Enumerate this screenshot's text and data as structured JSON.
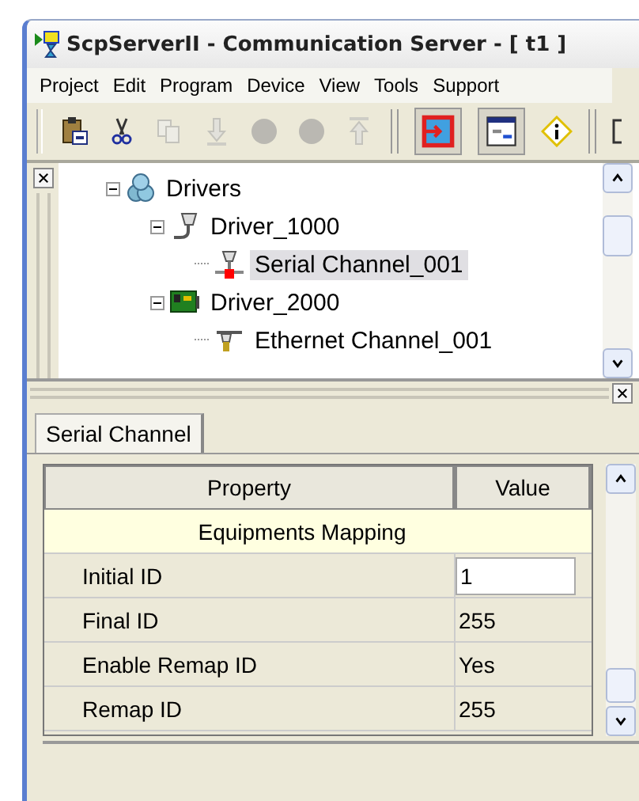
{
  "window": {
    "title": "ScpServerII - Communication Server - [ t1 ]"
  },
  "menu": [
    {
      "label": "Project"
    },
    {
      "label": "Edit"
    },
    {
      "label": "Program"
    },
    {
      "label": "Device"
    },
    {
      "label": "View"
    },
    {
      "label": "Tools"
    },
    {
      "label": "Support"
    }
  ],
  "toolbar": [
    {
      "kind": "paste",
      "disabled": false
    },
    {
      "kind": "cut",
      "disabled": false
    },
    {
      "kind": "copy",
      "disabled": true
    },
    {
      "kind": "download",
      "disabled": true
    },
    {
      "kind": "circle",
      "disabled": true
    },
    {
      "kind": "circle",
      "disabled": true
    },
    {
      "kind": "upload",
      "disabled": true
    },
    {
      "kind": "sep"
    },
    {
      "kind": "exit",
      "disabled": false
    },
    {
      "kind": "window",
      "disabled": false
    },
    {
      "kind": "info",
      "disabled": false
    },
    {
      "kind": "sep"
    },
    {
      "kind": "partial"
    }
  ],
  "tree": [
    {
      "label": "Drivers",
      "kind": "group",
      "expanded": true,
      "selected": false,
      "children": [
        {
          "label": "Driver_1000",
          "kind": "serial-driver",
          "expanded": true,
          "selected": false,
          "children": [
            {
              "label": "Serial Channel_001",
              "kind": "serial-channel",
              "selected": true
            }
          ]
        },
        {
          "label": "Driver_2000",
          "kind": "ethernet-driver",
          "expanded": true,
          "selected": false,
          "children": [
            {
              "label": "Ethernet Channel_001",
              "kind": "ethernet-channel",
              "selected": false
            }
          ]
        }
      ]
    }
  ],
  "tabs": [
    {
      "label": "Serial Channel",
      "selected": true
    }
  ],
  "table": {
    "columns": [
      "Property",
      "Value"
    ],
    "rows": [
      {
        "kind": "section",
        "label": "Equipments Mapping"
      },
      {
        "kind": "input",
        "property": "Initial ID",
        "value": "1"
      },
      {
        "kind": "text",
        "property": "Final ID",
        "value": "255"
      },
      {
        "kind": "text",
        "property": "Enable Remap ID",
        "value": "Yes"
      },
      {
        "kind": "text",
        "property": "Remap ID",
        "value": "255"
      }
    ]
  }
}
